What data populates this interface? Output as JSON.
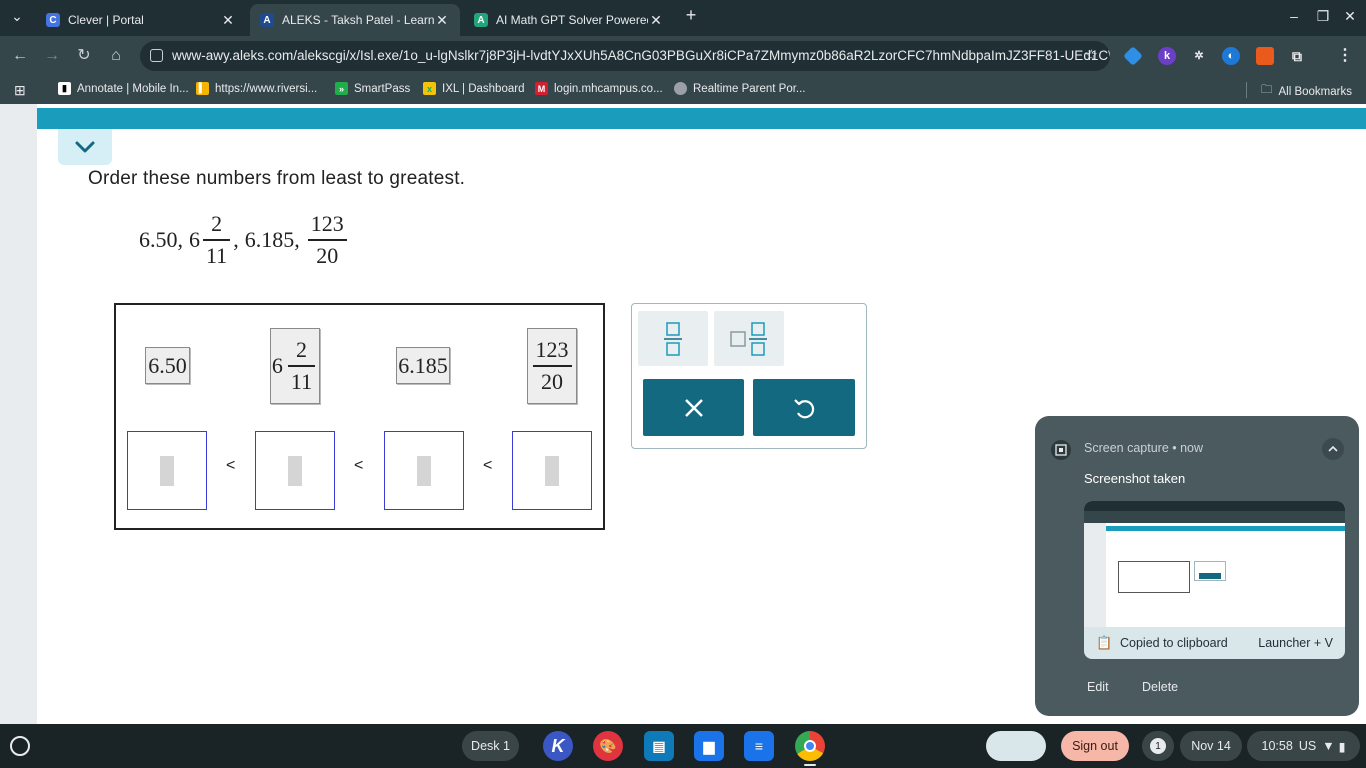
{
  "tabs": [
    {
      "title": "Clever | Portal",
      "favicon": "C",
      "favicon_color": "#4374e0"
    },
    {
      "title": "ALEKS - Taksh Patel - Learn",
      "favicon": "A",
      "favicon_color": "#1e4b8f"
    },
    {
      "title": "AI Math GPT Solver Powered b",
      "favicon": "A",
      "favicon_color": "#21a57a"
    }
  ],
  "toolbar": {
    "url": "www-awy.aleks.com/alekscgi/x/Isl.exe/1o_u-lgNslkr7j8P3jH-lvdtYJxXUh5A8CnG03PBGuXr8iCPa7ZMmymz0b86aR2LzorCFC7hmNdbpaImJZ3FF81-UEd1CW..."
  },
  "bookmarks": {
    "items": [
      {
        "label": "Annotate | Mobile In...",
        "color": "#ffffff"
      },
      {
        "label": "https://www.riversi...",
        "color": "#f6b400"
      },
      {
        "label": "SmartPass",
        "color": "#1fae4b"
      },
      {
        "label": "IXL | Dashboard",
        "color": "#f2c40c"
      },
      {
        "label": "login.mhcampus.co...",
        "color": "#d1202f"
      },
      {
        "label": "Realtime Parent Por...",
        "color": "#9aa0a6"
      }
    ],
    "all_label": "All Bookmarks"
  },
  "problem": {
    "instruction": "Order these numbers from least to greatest.",
    "expr": {
      "n1": "6.50,",
      "n2_whole": "6",
      "n2_num": "2",
      "n2_den": "11",
      "sep2": ",",
      "n3": "6.185,",
      "n4_num": "123",
      "n4_den": "20"
    },
    "tiles": {
      "t1": "6.50",
      "t2_whole": "6",
      "t2_num": "2",
      "t2_den": "11",
      "t3": "6.185",
      "t4_num": "123",
      "t4_den": "20"
    },
    "lt_symbol": "<"
  },
  "notification": {
    "source": "Screen capture",
    "time": "now",
    "title": "Screenshot taken",
    "clipboard": "Copied to clipboard",
    "shortcut": "Launcher + V",
    "edit": "Edit",
    "delete": "Delete"
  },
  "shelf": {
    "desk": "Desk 1",
    "signout": "Sign out",
    "badge": "1",
    "date": "Nov 14",
    "time": "10:58",
    "locale": "US"
  },
  "colors": {
    "teal_bar": "#1a9cbc",
    "keypad_dark": "#136a80",
    "slot_border": "#3b3bd6"
  }
}
